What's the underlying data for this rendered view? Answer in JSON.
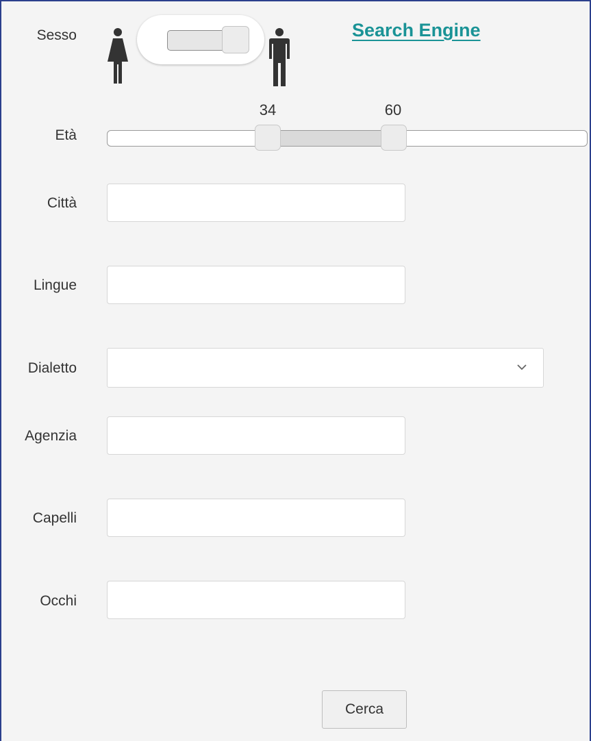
{
  "header": {
    "search_link": "Search Engine"
  },
  "form": {
    "sex": {
      "label": "Sesso",
      "value": "male"
    },
    "age": {
      "label": "Età",
      "min": "34",
      "max": "60"
    },
    "city": {
      "label": "Città",
      "value": ""
    },
    "languages": {
      "label": "Lingue",
      "value": ""
    },
    "dialect": {
      "label": "Dialetto",
      "value": ""
    },
    "agency": {
      "label": "Agenzia",
      "value": ""
    },
    "hair": {
      "label": "Capelli",
      "value": ""
    },
    "eyes": {
      "label": "Occhi",
      "value": ""
    },
    "submit_label": "Cerca"
  },
  "colors": {
    "link": "#1a9396",
    "border": "#2b3f8c"
  },
  "icons": [
    "female-icon",
    "male-icon",
    "chevron-down-icon"
  ]
}
